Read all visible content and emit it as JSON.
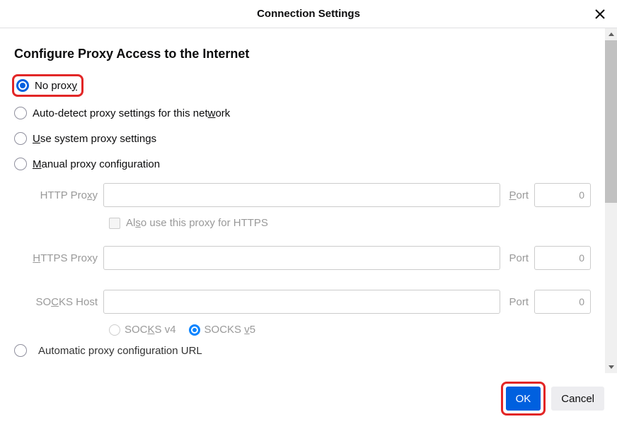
{
  "header": {
    "title": "Connection Settings"
  },
  "section": {
    "title": "Configure Proxy Access to the Internet"
  },
  "options": {
    "no_proxy": {
      "label_pre": "No prox",
      "label_u": "y",
      "label_post": ""
    },
    "auto_detect": {
      "label_pre": "Auto-detect proxy settings for this net",
      "label_u": "w",
      "label_post": "ork"
    },
    "system": {
      "label_pre": "",
      "label_u": "U",
      "label_post": "se system proxy settings"
    },
    "manual": {
      "label_pre": "",
      "label_u": "M",
      "label_post": "anual proxy configuration"
    },
    "auto_url": {
      "label": "Automatic proxy configuration URL"
    }
  },
  "fields": {
    "http": {
      "label_pre": "HTTP Pro",
      "label_u": "x",
      "label_post": "y",
      "port_pre": "",
      "port_u": "P",
      "port_post": "ort",
      "port_value": "0"
    },
    "https": {
      "label_pre": "",
      "label_u": "H",
      "label_post": "TTPS Proxy",
      "port_label": "Port",
      "port_value": "0"
    },
    "socks": {
      "label_pre": "SO",
      "label_u": "C",
      "label_post": "KS Host",
      "port_label": "Port",
      "port_value": "0"
    }
  },
  "checkbox": {
    "also_https": {
      "label_pre": "Al",
      "label_u": "s",
      "label_post": "o use this proxy for HTTPS"
    }
  },
  "socks_version": {
    "v4": {
      "label_pre": "SOC",
      "label_u": "K",
      "label_post": "S v4"
    },
    "v5": {
      "label_pre": "SOCKS ",
      "label_u": "v",
      "label_post": "5"
    }
  },
  "footer": {
    "ok": "OK",
    "cancel": "Cancel"
  }
}
